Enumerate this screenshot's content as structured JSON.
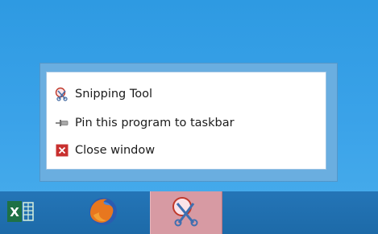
{
  "jumplist": {
    "items": [
      {
        "label": "Snipping Tool",
        "icon": "scissors-icon"
      },
      {
        "label": "Pin this program to taskbar",
        "icon": "pin-icon"
      },
      {
        "label": "Close window",
        "icon": "close-icon"
      }
    ]
  },
  "taskbar": {
    "apps": [
      {
        "icon": "excel-icon"
      },
      {
        "icon": "firefox-icon"
      },
      {
        "icon": "snipping-tool-icon",
        "active": true
      }
    ]
  },
  "colors": {
    "desktop": "#3ba3e9",
    "taskbar": "#1f6fb0",
    "active_button": "#d79aa3",
    "close_red": "#c8302f",
    "excel_green": "#1e7145"
  }
}
